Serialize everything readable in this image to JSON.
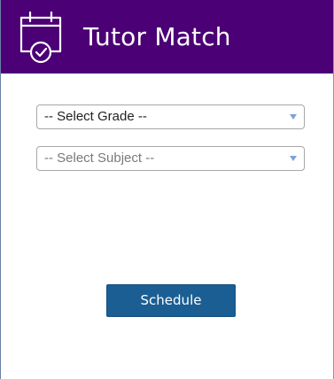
{
  "header": {
    "title": "Tutor Match",
    "icon": "calendar-check-icon",
    "background": "#4b0075"
  },
  "form": {
    "grade_select": {
      "value": "-- Select Grade --"
    },
    "subject_select": {
      "value": "-- Select Subject --"
    }
  },
  "actions": {
    "schedule_label": "Schedule",
    "schedule_color": "#1b5e94"
  }
}
